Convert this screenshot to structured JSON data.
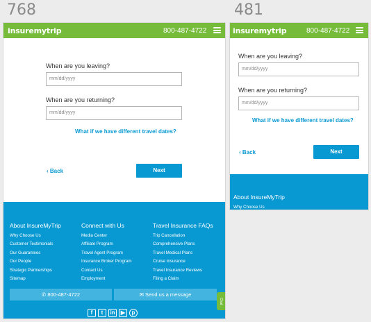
{
  "labels": {
    "left": "768",
    "right": "481"
  },
  "brand": {
    "logo": "insuremytrip",
    "phone": "800-487-4722"
  },
  "form": {
    "leaving_label": "When are you leaving?",
    "returning_label": "When are you returning?",
    "date_placeholder": "mm/dd/yyyy",
    "different_dates_link": "What if we have different travel dates?",
    "back_label": "Back",
    "next_label": "Next"
  },
  "footer": {
    "col1": {
      "title": "About InsureMyTrip",
      "links": [
        "Why Choose Us",
        "Customer Testimonials",
        "Our Guarantees",
        "Our People",
        "Strategic Partnerships",
        "Sitemap"
      ]
    },
    "col2": {
      "title": "Connect with Us",
      "links": [
        "Media Center",
        "Affiliate Program",
        "Travel Agent Program",
        "Insurance Broker Program",
        "Contact Us",
        "Employment"
      ]
    },
    "col3": {
      "title": "Travel Insurance FAQs",
      "links": [
        "Trip Cancellation",
        "Comprehensive Plans",
        "Travel Medical Plans",
        "Cruise Insurance",
        "Travel Insurance Reviews",
        "Filing a Claim"
      ]
    },
    "call_button": "800-487-4722",
    "message_button": "Send us a message",
    "chat_tab": "Chat"
  },
  "colors": {
    "brand_green": "#76bc3a",
    "brand_blue": "#0899d2"
  }
}
